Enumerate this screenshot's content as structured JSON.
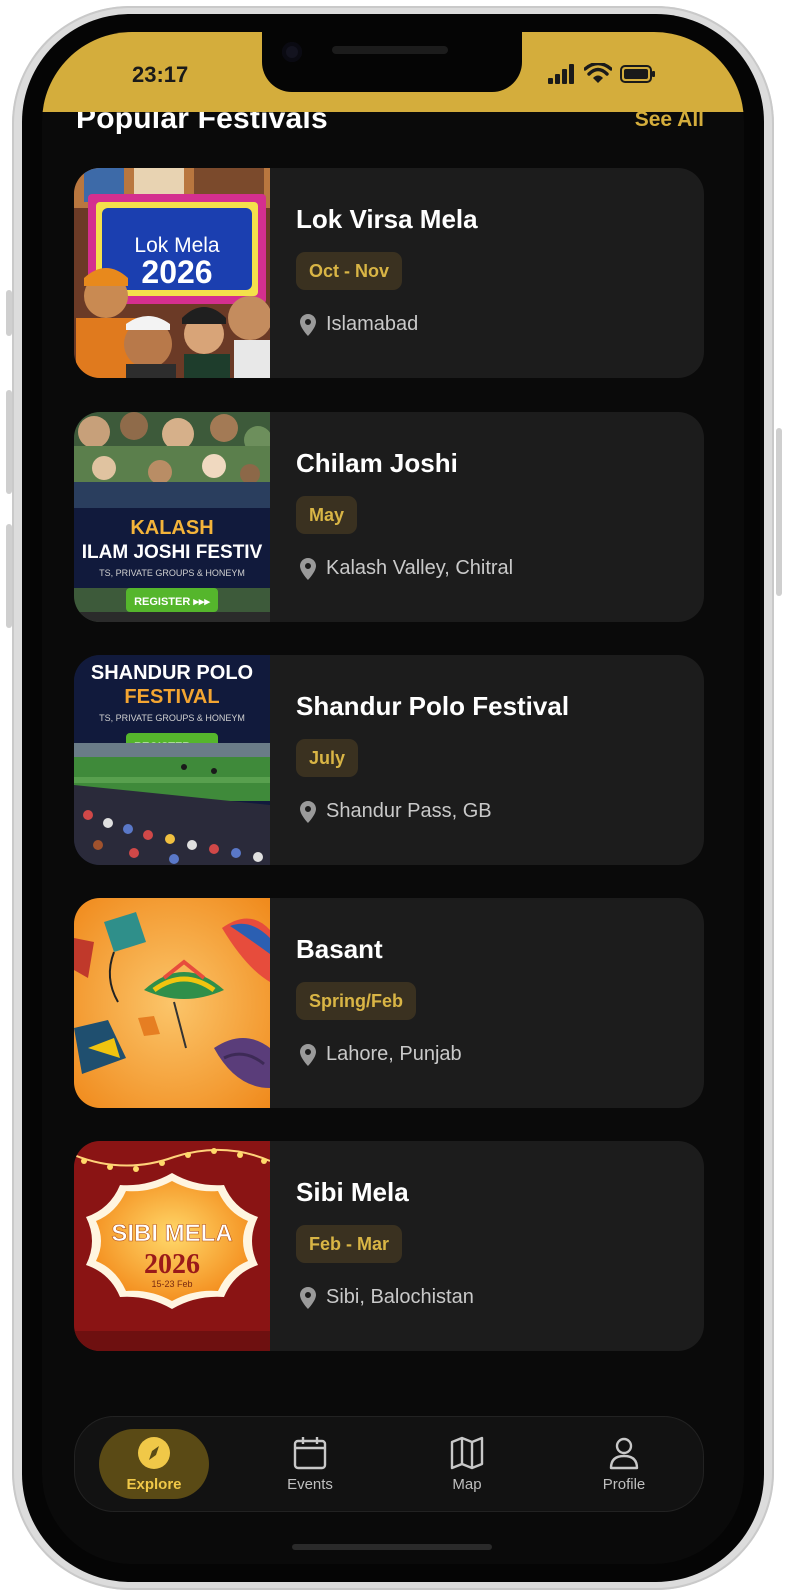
{
  "status_bar": {
    "time": "23:17"
  },
  "colors": {
    "accent": "#d4ad3c",
    "card": "#1c1c1c",
    "background": "#0a0a0a",
    "pill_bg": "#3a3120"
  },
  "section": {
    "title": "Popular Festivals",
    "see_all": "See All"
  },
  "festivals": [
    {
      "name": "Lok Virsa Mela",
      "dates": "Oct - Nov",
      "location": "Islamabad",
      "thumb": {
        "line1": "Lok Mela",
        "line2": "2026"
      }
    },
    {
      "name": "Chilam Joshi",
      "dates": "May",
      "location": "Kalash Valley, Chitral",
      "thumb": {
        "line1": "KALASH",
        "line2": "ILAM JOSHI FESTIV",
        "line3": "TS, PRIVATE GROUPS & HONEYM",
        "button": "REGISTER ▸▸▸"
      }
    },
    {
      "name": "Shandur Polo Festival",
      "dates": "July",
      "location": "Shandur Pass, GB",
      "thumb": {
        "line1": "SHANDUR POLO",
        "line2": "FESTIVAL",
        "line3": "TS, PRIVATE GROUPS & HONEYM",
        "button": "REGISTER ▸▸▸"
      }
    },
    {
      "name": "Basant",
      "dates": "Spring/Feb",
      "location": "Lahore, Punjab",
      "thumb": {}
    },
    {
      "name": "Sibi Mela",
      "dates": "Feb - Mar",
      "location": "Sibi, Balochistan",
      "thumb": {
        "line1": "SIBI MELA",
        "line2": "2026",
        "line3": "15-23 Feb"
      }
    }
  ],
  "bottom_nav": {
    "items": [
      {
        "label": "Explore",
        "icon": "compass-icon",
        "active": true
      },
      {
        "label": "Events",
        "icon": "calendar-icon",
        "active": false
      },
      {
        "label": "Map",
        "icon": "map-icon",
        "active": false
      },
      {
        "label": "Profile",
        "icon": "user-icon",
        "active": false
      }
    ]
  }
}
